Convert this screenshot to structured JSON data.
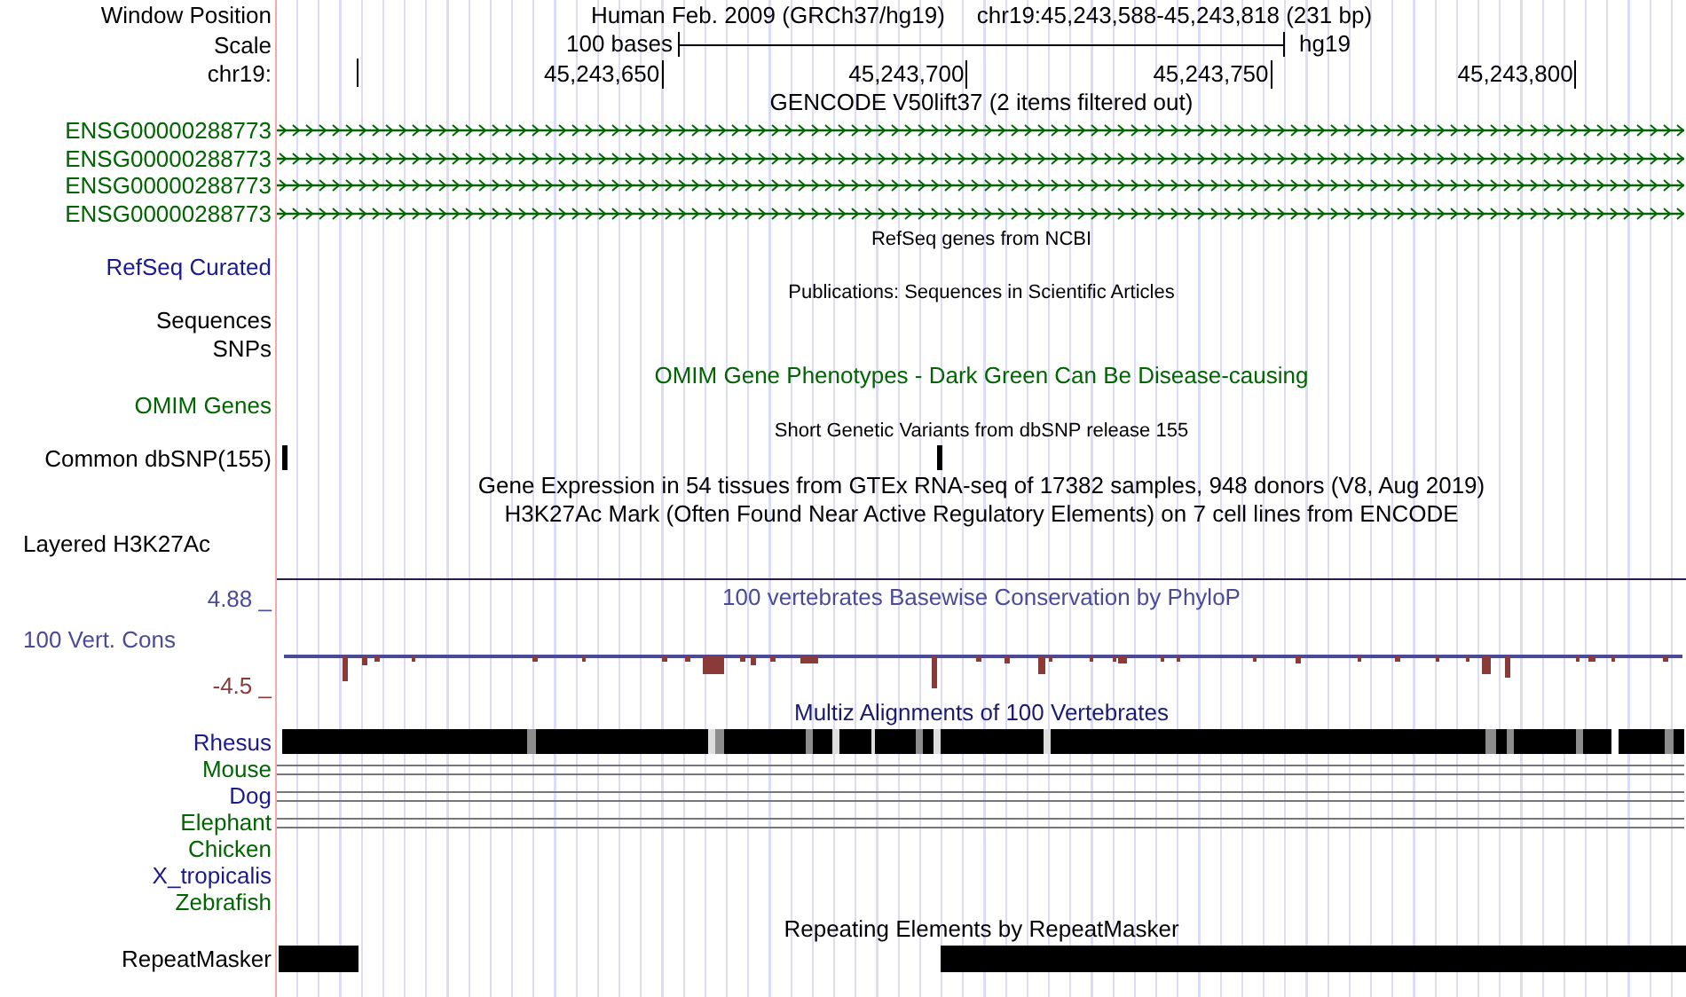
{
  "header": {
    "label": "Window Position",
    "assembly": "Human Feb. 2009 (GRCh37/hg19)",
    "position": "chr19:45,243,588-45,243,818 (231 bp)"
  },
  "scale": {
    "label": "Scale",
    "length": "100 bases",
    "assembly": "hg19"
  },
  "ruler": {
    "label": "chr19:",
    "ticks": [
      "45,243,650",
      "45,243,700",
      "45,243,750",
      "45,243,800"
    ]
  },
  "tracks": [
    {
      "kind": "title",
      "text": "GENCODE V50lift37 (2 items filtered out)",
      "color": "#000000"
    },
    {
      "kind": "gene",
      "label": "ENSG00000288773",
      "color": "#006400"
    },
    {
      "kind": "gene",
      "label": "ENSG00000288773",
      "color": "#006400"
    },
    {
      "kind": "gene",
      "label": "ENSG00000288773",
      "color": "#006400"
    },
    {
      "kind": "gene",
      "label": "ENSG00000288773",
      "color": "#006400"
    },
    {
      "kind": "note",
      "text": "RefSeq genes from NCBI"
    },
    {
      "kind": "label",
      "label": "RefSeq Curated",
      "color": "#1a1a8c"
    },
    {
      "kind": "note",
      "text": "Publications: Sequences in Scientific Articles"
    },
    {
      "kind": "label",
      "label": "Sequences",
      "color": "#000000"
    },
    {
      "kind": "label",
      "label": "SNPs",
      "color": "#000000"
    },
    {
      "kind": "title",
      "text": "OMIM Gene Phenotypes - Dark Green Can Be Disease-causing",
      "color": "#006400"
    },
    {
      "kind": "label",
      "label": "OMIM Genes",
      "color": "#006400"
    },
    {
      "kind": "note",
      "text": "Short Genetic Variants from dbSNP release 155"
    },
    {
      "kind": "snp",
      "label": "Common dbSNP(155)"
    },
    {
      "kind": "title",
      "text": "Gene Expression in 54 tissues from GTEx RNA-seq of 17382 samples, 948 donors (V8, Aug 2019)",
      "color": "#000000"
    },
    {
      "kind": "title",
      "text": "H3K27Ac Mark (Often Found Near Active Regulatory Elements) on 7 cell lines from ENCODE",
      "color": "#000000"
    },
    {
      "kind": "signal",
      "label": "Layered H3K27Ac"
    },
    {
      "kind": "conservation",
      "label": "100 Vert. Cons",
      "title": "100 vertebrates Basewise Conservation by PhyloP",
      "max": "4.88 _",
      "min": "-4.5 _"
    },
    {
      "kind": "title",
      "text": "Multiz Alignments of 100 Vertebrates",
      "color": "#1a1a6e"
    },
    {
      "kind": "maf_bar",
      "label": "Rhesus",
      "color": "#1a1a8c"
    },
    {
      "kind": "maf_lines",
      "label": "Mouse",
      "color": "#006400"
    },
    {
      "kind": "maf_lines",
      "label": "Dog",
      "color": "#1a1a8c"
    },
    {
      "kind": "maf_lines",
      "label": "Elephant",
      "color": "#006400"
    },
    {
      "kind": "species",
      "label": "Chicken",
      "color": "#006400"
    },
    {
      "kind": "species",
      "label": "X_tropicalis",
      "color": "#1a1a8c"
    },
    {
      "kind": "species",
      "label": "Zebrafish",
      "color": "#006400"
    },
    {
      "kind": "title",
      "text": "Repeating Elements by RepeatMasker",
      "color": "#000000"
    },
    {
      "kind": "repeat",
      "label": "RepeatMasker"
    }
  ]
}
